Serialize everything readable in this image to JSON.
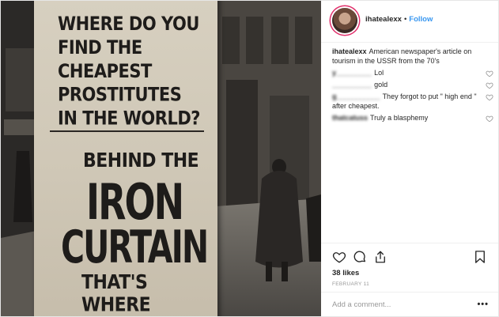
{
  "poster": {
    "question": [
      "WHERE DO YOU",
      "FIND THE CHEAPEST",
      "PROSTITUTES",
      "IN THE WORLD?"
    ],
    "answer_1": "BEHIND THE",
    "answer_2": "IRON",
    "answer_3": "CURTAIN",
    "answer_4": "THAT'S WHERE"
  },
  "header": {
    "username": "ihatealexx",
    "separator": "•",
    "follow_label": "Follow"
  },
  "caption": {
    "username": "ihatealexx",
    "text": "American newspaper's article on tourism in the USSR from the 70's"
  },
  "comments": [
    {
      "username": "y_________",
      "text": "Lol"
    },
    {
      "username": "__________",
      "text": "gold"
    },
    {
      "username": "g___________",
      "text": "They forgot to put \" high end \" after cheapest."
    },
    {
      "username": "thatcatuss",
      "text": "Truly a blasphemy"
    }
  ],
  "actions": {
    "icons": [
      "heart-icon",
      "comment-icon",
      "share-icon",
      "bookmark-icon"
    ],
    "likes": "38 likes",
    "date": "FEBRUARY 11"
  },
  "add_comment": {
    "placeholder": "Add a comment...",
    "more_label": "•••"
  },
  "colors": {
    "link_blue": "#3897f0",
    "text": "#262626",
    "muted": "#999999"
  }
}
